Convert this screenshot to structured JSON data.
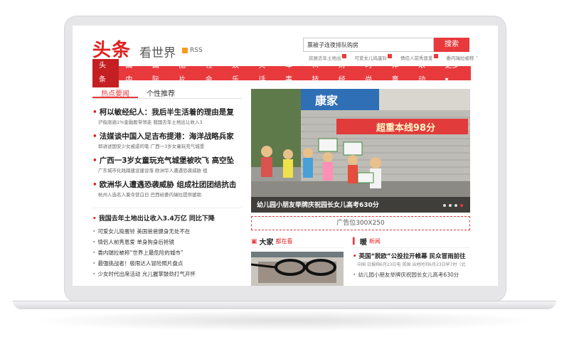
{
  "header": {
    "logo": "头条",
    "logo_sub": "看世界",
    "rss": "RSS",
    "search_value": "票被子连夜排队购房",
    "search_button": "搜索",
    "hot_words": [
      "房展去年土地出",
      "可爱女儿捣蛋铃",
      "情侣人前秀恩爱",
      "委内瑞拉被称"
    ]
  },
  "nav": {
    "items": [
      "头条",
      "国内",
      "国际",
      "图片",
      "社会",
      "娱乐",
      "笑话",
      "军事",
      "科技",
      "财经",
      "时尚",
      "体育",
      "滚动",
      "更多"
    ],
    "hot_badge": "HOT"
  },
  "tabs": [
    "热点要闻",
    "个性推荐"
  ],
  "headlines": [
    {
      "title": "柯以敏经纪人：我后半生活着的理由是复",
      "sub": "沪指涨逾1%金融股带领走   我国去年土地出让收入3"
    },
    {
      "title": "法媒谈中国入足吉布提港：海洋战略兵家",
      "sub": "郎讲述国安少女被虐的笔   广西一3岁女童玩充气城堡"
    },
    {
      "title": "广西一3岁女童玩充气城堡被吹飞 高空坠",
      "sub": "广东城市化践踏建设建设落   欧洲华人遭遇恐袭威胁 组"
    },
    {
      "title": "欧洲华人遭遇恐袭威胁 组成社团团结抗击",
      "sub": "杭州入选名人夏令营白日   巴西给委内瑞拉提供援助"
    }
  ],
  "list": [
    "我国去年土地出让收入3.4万亿 同比下降",
    "可爱女儿捣蛋铃 美国爸爸健身无处不在",
    "情侣人前秀恩爱 单身狗身后抢镜",
    "委内瑞拉被称“世界上最危险的城市”",
    "最强挑战者！极限达人冒险照片盘点",
    "少女时代出席活动 允儿握掌鼓劲打气开怀"
  ],
  "slider": {
    "caption": "幼儿园小朋友举牌庆祝园长女儿高考630分",
    "banner_text": "超重本线98分",
    "shop_sign": "康家",
    "dots": 4,
    "active_dot": 3
  },
  "ad": "广告位300X250",
  "sections": {
    "left_title": "大家",
    "left_accent": "都在看",
    "right_title": "暖",
    "right_accent": "新闻"
  },
  "right_news": {
    "bold": "英国“脱欧”公投拉开帷幕 民众冒雨前往",
    "meta": "中国 日报网6月23日电 英国 当地时间6月23日早7时（北",
    "item": "幼儿园小朋友举牌庆祝园长女儿高考630分"
  },
  "colors": {
    "brand_red": "#e8393c",
    "nav_active": "#c41f22"
  }
}
